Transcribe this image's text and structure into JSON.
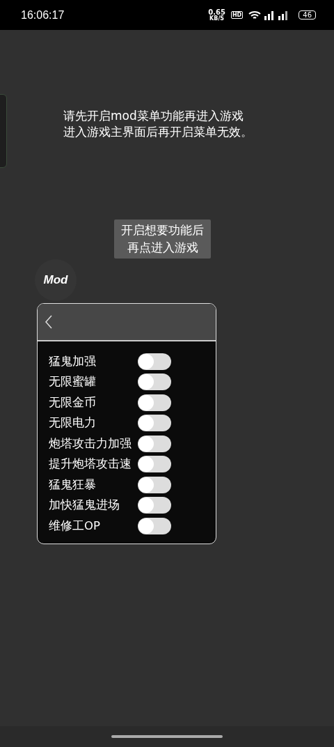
{
  "status_bar": {
    "time": "16:06:17",
    "net_speed": "0.65",
    "net_unit": "KB/S",
    "hd": "HD",
    "battery": "46"
  },
  "notice": [
    "请先开启mod菜单功能再进入游戏",
    "进入游戏主界面后再开启菜单无效。"
  ],
  "start_button": {
    "lines": [
      "开启想要功能后",
      "再点进入游戏"
    ]
  },
  "mod_logo": "Mod",
  "menu": {
    "items": [
      {
        "label": "猛鬼加强",
        "on": false
      },
      {
        "label": "无限蜜罐",
        "on": false
      },
      {
        "label": "无限金币",
        "on": false
      },
      {
        "label": "无限电力",
        "on": false
      },
      {
        "label": "炮塔攻击力加强",
        "on": false
      },
      {
        "label": "提升炮塔攻击速",
        "on": false
      },
      {
        "label": "猛鬼狂暴",
        "on": false
      },
      {
        "label": "加快猛鬼进场",
        "on": false
      },
      {
        "label": "维修工OP",
        "on": false
      }
    ]
  }
}
